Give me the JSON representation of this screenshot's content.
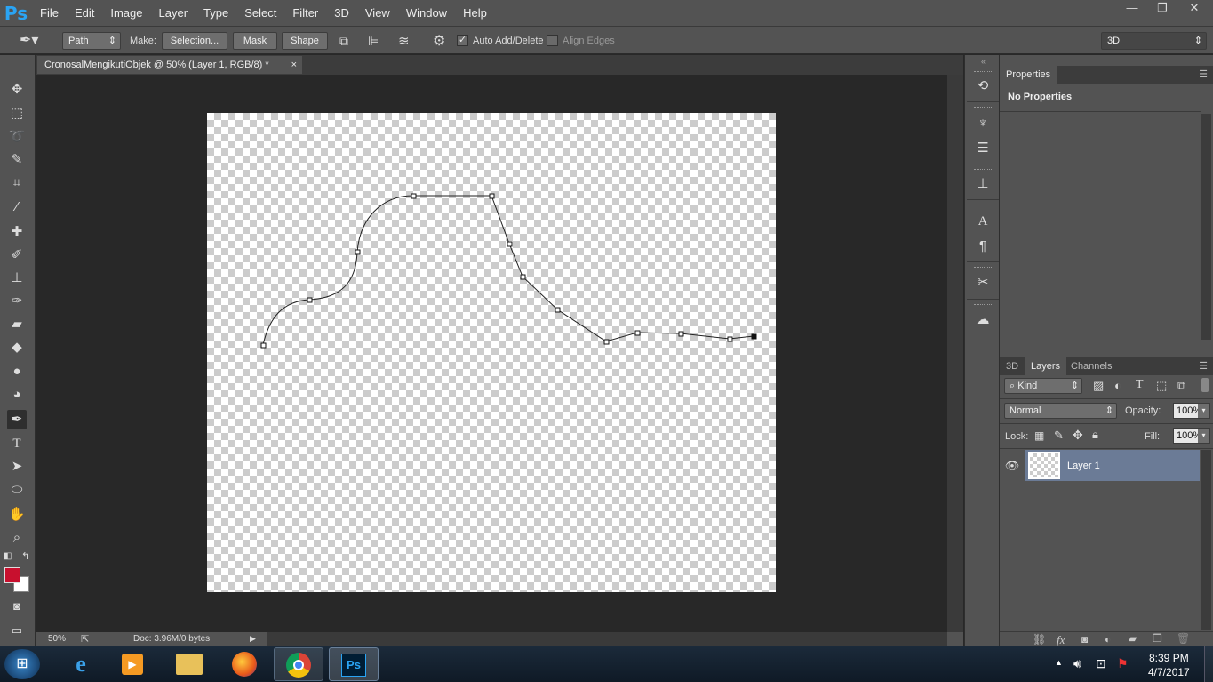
{
  "app": {
    "logo": "Ps"
  },
  "menu": [
    "File",
    "Edit",
    "Image",
    "Layer",
    "Type",
    "Select",
    "Filter",
    "3D",
    "View",
    "Window",
    "Help"
  ],
  "window_controls": {
    "minimize": "—",
    "restore": "❐",
    "close": "✕"
  },
  "options_bar": {
    "tool_mode": "Path",
    "make_label": "Make:",
    "selection_button": "Selection...",
    "mask_button": "Mask",
    "shape_button": "Shape",
    "auto_add_delete": "Auto Add/Delete",
    "align_edges": "Align Edges",
    "workspace": "3D"
  },
  "document_tab": {
    "title": "CronosalMengikutiObjek @ 50% (Layer 1, RGB/8) *",
    "close": "×"
  },
  "status": {
    "zoom": "50%",
    "doc": "Doc: 3.96M/0 bytes"
  },
  "colors": {
    "foreground": "#c8102e",
    "background": "#ffffff",
    "ui_bg": "#535353",
    "selected_layer": "#6b7b96"
  },
  "tools": [
    "move-icon",
    "marquee-icon",
    "lasso-icon",
    "quick-select-icon",
    "crop-icon",
    "eyedropper-icon",
    "healing-brush-icon",
    "brush-icon",
    "clone-stamp-icon",
    "history-brush-icon",
    "eraser-icon",
    "paint-bucket-icon",
    "blur-icon",
    "dodge-icon",
    "pen-icon",
    "type-icon",
    "path-select-icon",
    "ellipse-icon",
    "hand-icon",
    "zoom-icon"
  ],
  "properties_panel": {
    "tab": "Properties",
    "content": "No Properties"
  },
  "layers_panel": {
    "tabs": [
      "3D",
      "Layers",
      "Channels"
    ],
    "active_tab": "Layers",
    "filter_kind": "Kind",
    "blend_mode": "Normal",
    "opacity_label": "Opacity:",
    "opacity": "100%",
    "lock_label": "Lock:",
    "fill_label": "Fill:",
    "fill": "100%",
    "layers": [
      {
        "name": "Layer 1",
        "visible": true
      }
    ],
    "footer_fx": "fx"
  },
  "taskbar": {
    "time": "8:39 PM",
    "date": "4/7/2017",
    "show_hidden": "▲"
  }
}
